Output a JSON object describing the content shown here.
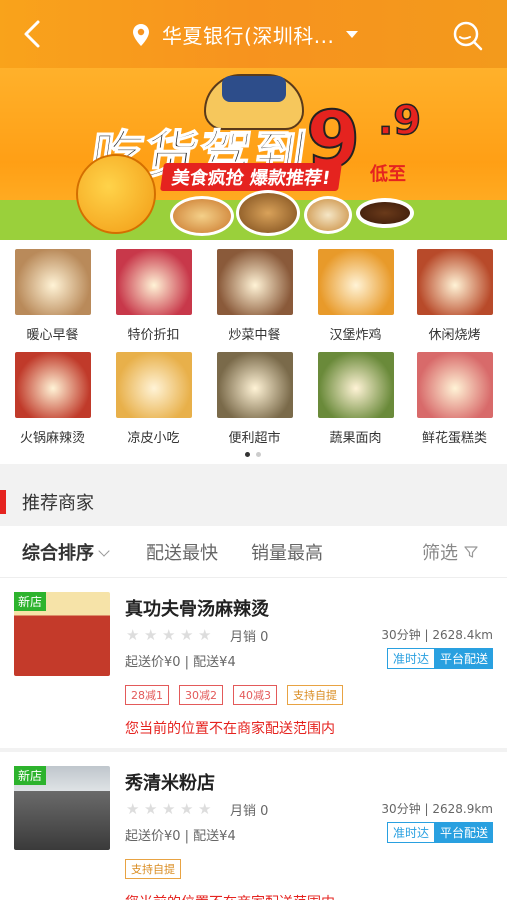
{
  "header": {
    "location": "华夏银行(深圳科...",
    "icons": {
      "back": "chevron-left-icon",
      "pin": "location-pin-icon",
      "caret": "caret-down-icon",
      "search": "search-icon"
    }
  },
  "banner": {
    "slogan": "吃货驾到",
    "price_big": "9",
    "price_small": ".9",
    "price_suffix": "低至",
    "subtitle": "美食疯抢  爆款推荐!",
    "colors": {
      "bg": "#ff9f15",
      "accent": "#e5231f",
      "grass": "#9ad03b"
    }
  },
  "categories": [
    {
      "label": "暖心早餐",
      "color": "#b98a5a"
    },
    {
      "label": "特价折扣",
      "color": "#c8384a"
    },
    {
      "label": "炒菜中餐",
      "color": "#8a5a3a"
    },
    {
      "label": "汉堡炸鸡",
      "color": "#e89a2a"
    },
    {
      "label": "休闲烧烤",
      "color": "#b84a2a"
    },
    {
      "label": "火锅麻辣烫",
      "color": "#c03a2a"
    },
    {
      "label": "凉皮小吃",
      "color": "#e8b04a"
    },
    {
      "label": "便利超市",
      "color": "#7a6a4a"
    },
    {
      "label": "蔬果面肉",
      "color": "#6a8a3a"
    },
    {
      "label": "鲜花蛋糕类",
      "color": "#d86a6a"
    }
  ],
  "pager": {
    "total": 2,
    "active": 0
  },
  "section": {
    "title": "推荐商家"
  },
  "sort": {
    "options": [
      "综合排序",
      "配送最快",
      "销量最高"
    ],
    "filter": "筛选"
  },
  "shops": [
    {
      "badge": "新店",
      "name": "真功夫骨汤麻辣烫",
      "rating": 0,
      "monthly": "月销 0",
      "eta": "30分钟 | 2628.4km",
      "price": "起送价¥0 | 配送¥4",
      "tag_ontime": "准时达",
      "tag_platform": "平台配送",
      "promos": [
        "28减1",
        "30减2",
        "40减3"
      ],
      "pickup": "支持自提",
      "warning": "您当前的位置不在商家配送范围内"
    },
    {
      "badge": "新店",
      "name": "秀清米粉店",
      "rating": 0,
      "monthly": "月销 0",
      "eta": "30分钟 | 2628.9km",
      "price": "起送价¥0 | 配送¥4",
      "tag_ontime": "准时达",
      "tag_platform": "平台配送",
      "promos": [],
      "pickup": "支持自提",
      "warning": "您当前的位置不在商家配送范围内"
    }
  ]
}
